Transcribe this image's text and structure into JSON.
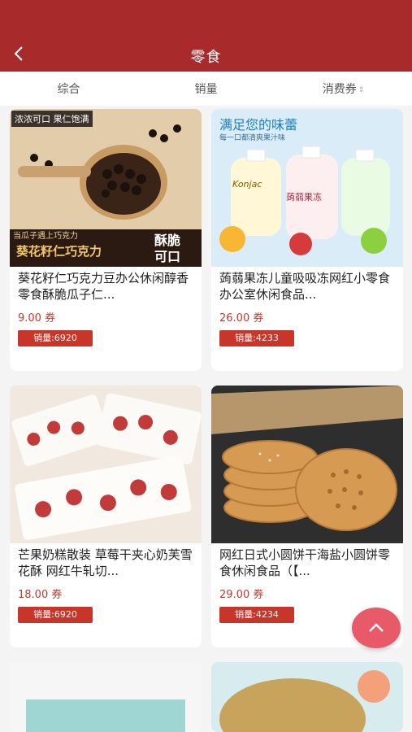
{
  "header": {
    "title": "零食",
    "back_icon": "chevron-left-icon",
    "background": "#a82a2a"
  },
  "tabs": [
    {
      "label": "综合"
    },
    {
      "label": "销量"
    },
    {
      "label": "消费券",
      "icon": "sort-icon"
    }
  ],
  "products": [
    {
      "name": "葵花籽仁巧克力豆办公休闲醇香零食酥脆瓜子仁...",
      "price": "9.00 券",
      "sales": "销量:6920",
      "image_text": {
        "tag1": "浓浓可口 果仁饱满",
        "tag2": "当瓜子遇上巧克力",
        "banner": "葵花籽仁巧克力",
        "side": "酥脆 可口"
      }
    },
    {
      "name": "蒟蒻果冻儿童吸吸冻网红小零食办公室休闲食品...",
      "price": "26.00 券",
      "sales": "销量:4233",
      "image_text": {
        "headline": "满足您的味蕾",
        "sub": "每一口都清爽果汁味",
        "brand": "Konjac",
        "pouch": "蒟蒻果冻"
      }
    },
    {
      "name": "芒果奶糕散装 草莓干夹心奶芙雪花酥 网红牛轧切...",
      "price": "18.00 券",
      "sales": "销量:6920"
    },
    {
      "name": "网红日式小圆饼干海盐小圆饼零食休闲食品（【...",
      "price": "29.00 券",
      "sales": "销量:4234"
    }
  ],
  "colors": {
    "accent": "#a82a2a",
    "price": "#c0392b",
    "badge": "#c8362a",
    "fab": "#e85a6a"
  },
  "fab_icon": "chevron-up-icon"
}
